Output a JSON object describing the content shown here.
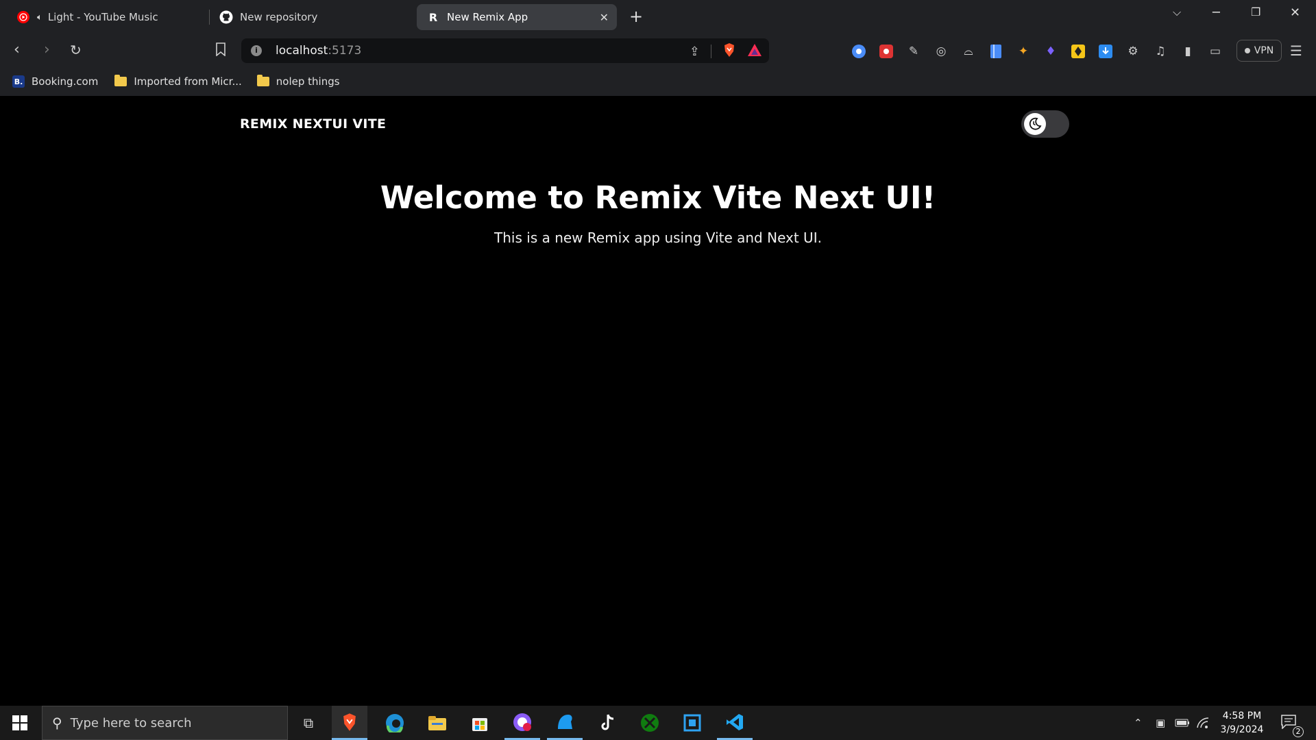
{
  "browser": {
    "tabs": [
      {
        "title": "Light - YouTube Music",
        "active": false
      },
      {
        "title": "New repository",
        "active": false
      },
      {
        "title": "New Remix App",
        "active": true
      }
    ],
    "new_tab_label": "+",
    "address": {
      "host": "localhost",
      "port": ":5173"
    },
    "vpn_label": "VPN",
    "bookmarks": [
      {
        "label": "Booking.com",
        "icon": "B."
      },
      {
        "label": "Imported from Micr..."
      },
      {
        "label": "nolep things"
      }
    ]
  },
  "page": {
    "brand": "REMIX NEXTUI VITE",
    "title": "Welcome to Remix Vite Next UI!",
    "subtitle": "This is a new Remix app using Vite and Next UI."
  },
  "taskbar": {
    "search_placeholder": "Type here to search",
    "time": "4:58 PM",
    "date": "3/9/2024",
    "notification_count": "2"
  },
  "colors": {
    "chrome_bg": "#202124",
    "page_bg": "#000000",
    "taskbar_bg": "#1a1a1a",
    "accent_blue": "#76b9ed"
  }
}
